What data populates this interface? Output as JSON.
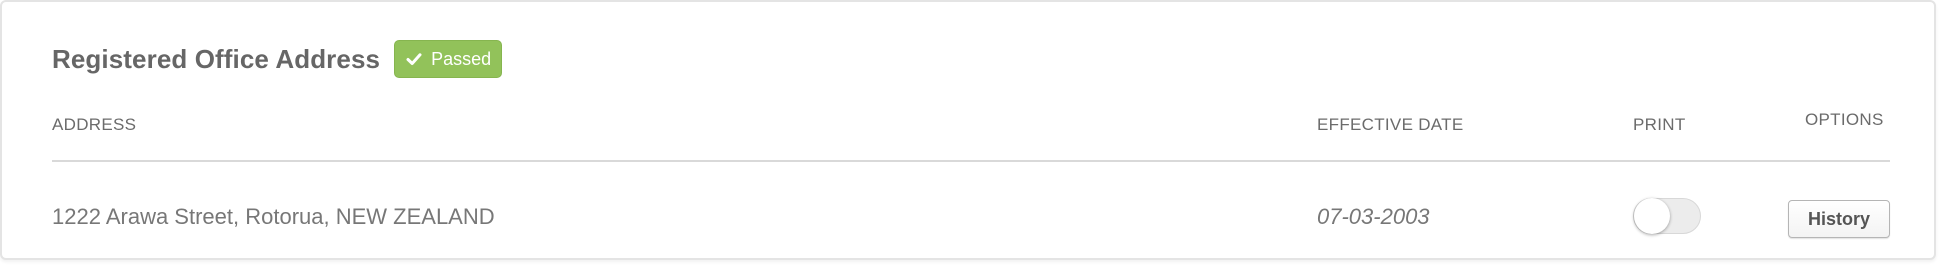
{
  "section": {
    "title": "Registered Office Address",
    "status_badge": {
      "label": "Passed",
      "icon": "checkmark-icon",
      "color": "#92c25a"
    }
  },
  "table": {
    "columns": {
      "address": "ADDRESS",
      "effective_date": "EFFECTIVE DATE",
      "print": "PRINT",
      "options": "OPTIONS"
    },
    "rows": [
      {
        "address": "1222 Arawa Street, Rotorua, NEW ZEALAND",
        "effective_date": "07-03-2003",
        "print_enabled": false,
        "options_button": "History"
      }
    ]
  }
}
